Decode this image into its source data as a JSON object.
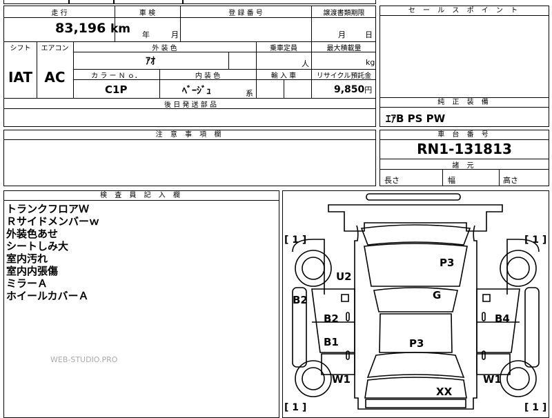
{
  "grid": {
    "mileage_header": "走 行",
    "mileage_value": "83,196",
    "mileage_unit": "km",
    "inspection_header": "車 検",
    "inspection_year_unit": "年",
    "inspection_month_unit": "月",
    "registration_header": "登 録 番 号",
    "transfer_header": "譲渡書類期限",
    "transfer_month_unit": "月",
    "transfer_day_unit": "日",
    "shift_header": "シフト",
    "shift_value": "IAT",
    "aircon_header": "エアコン",
    "aircon_value": "AC",
    "exterior_color_header": "外 装 色",
    "exterior_color_value": "ｱｵ",
    "capacity_header": "乗車定員",
    "capacity_unit": "人",
    "max_load_header": "最大積載量",
    "max_load_unit": "kg",
    "color_no_header": "カ ラ ー Ｎ ｏ．",
    "color_no_value": "C1P",
    "interior_color_header": "内 装 色",
    "interior_color_value": "ﾍﾞｰｼﾞｭ",
    "interior_color_suffix": "系",
    "import_header": "輸 入 車",
    "recycle_header": "リサイクル預託金",
    "recycle_value": "9,850",
    "recycle_unit": "円",
    "delivery_parts_header": "後 日 発 送 部 品"
  },
  "sales_point": {
    "header": "セ ー ル ス ポ イ ン ト"
  },
  "equipment": {
    "header": "純 正 装 備",
    "value": "ｴｱB PS PW"
  },
  "notes": {
    "header": "注 意 事 項 欄"
  },
  "chassis": {
    "header": "車 台 番 号",
    "value": "RN1-131813",
    "dims_header": "諸 元",
    "length_label": "長さ",
    "width_label": "幅",
    "height_label": "高さ"
  },
  "inspector": {
    "header": "検 査 員 記 入 欄",
    "lines": [
      "トランクフロアＷ",
      "Ｒサイドメンバーｗ",
      "外装色あせ",
      "シートしみ大",
      "室内汚れ",
      "室内内張傷",
      "ミラーＡ",
      "ホイールカバーＡ"
    ]
  },
  "watermark": "WEB-STUDIO.PRO",
  "diagram": {
    "marks": {
      "u2": "U2",
      "p3_top": "P3",
      "g": "G",
      "b2_left": "B2",
      "b2_inner": "B2",
      "b4": "B4",
      "b1": "B1",
      "p3_mid": "P3",
      "w1_left": "W1",
      "w1_right": "W1",
      "xx": "XX"
    },
    "tire_tl": "[ 1 ]",
    "tire_tr": "[ 1 ]",
    "tire_bl": "[ 1 ]",
    "tire_br": "[ 1 ]"
  }
}
